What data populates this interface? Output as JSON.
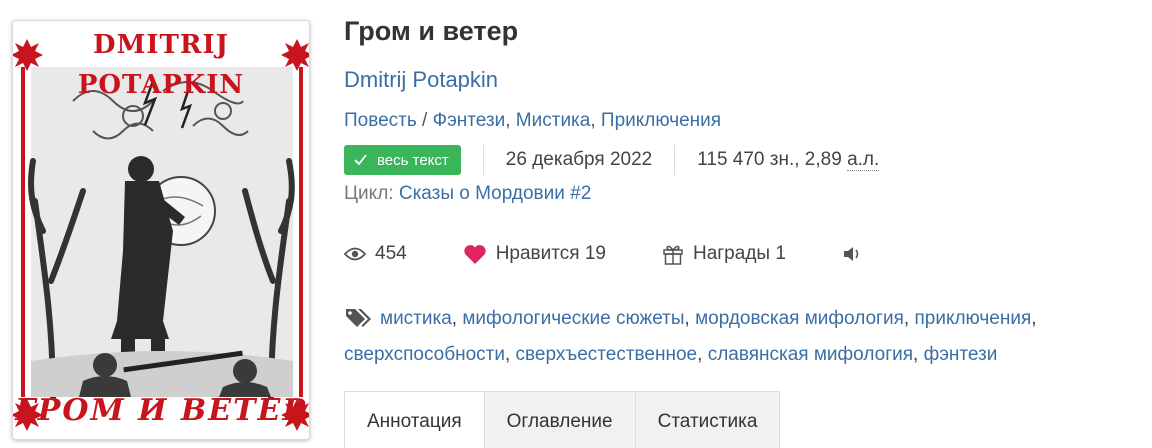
{
  "cover": {
    "author_text": "DMITRIJ POTAPKIN",
    "title_text": "ГРОМ И ВЕТЕР"
  },
  "book": {
    "title": "Гром и ветер",
    "author": "Dmitrij Potapkin"
  },
  "genres": {
    "form": "Повесть",
    "separator": " / ",
    "items": [
      "Фэнтези",
      "Мистика",
      "Приключения"
    ]
  },
  "meta": {
    "badge_label": "весь текст",
    "date": "26 декабря 2022",
    "size_prefix": "115 470 зн., 2,89",
    "size_unit": "а.л."
  },
  "cycle": {
    "label": "Цикл:",
    "name": "Сказы о Мордовии #2"
  },
  "stats": {
    "views": "454",
    "likes_label": "Нравится",
    "likes_count": "19",
    "awards_label": "Награды",
    "awards_count": "1"
  },
  "tags": [
    "мистика",
    "мифологические сюжеты",
    "мордовская мифология",
    "приключения",
    "сверхспособности",
    "сверхъестественное",
    "славянская мифология",
    "фэнтези"
  ],
  "tabs": [
    "Аннотация",
    "Оглавление",
    "Статистика"
  ],
  "colors": {
    "accent": "#3a6ea5",
    "badge": "#3bb55a",
    "like": "#e0245e",
    "cover_red": "#c8141c"
  },
  "icons": {
    "views": "eye-icon",
    "likes": "heart-icon",
    "awards": "gift-icon",
    "audio": "speaker-icon",
    "tags": "tag-icon",
    "badge": "check-icon"
  }
}
